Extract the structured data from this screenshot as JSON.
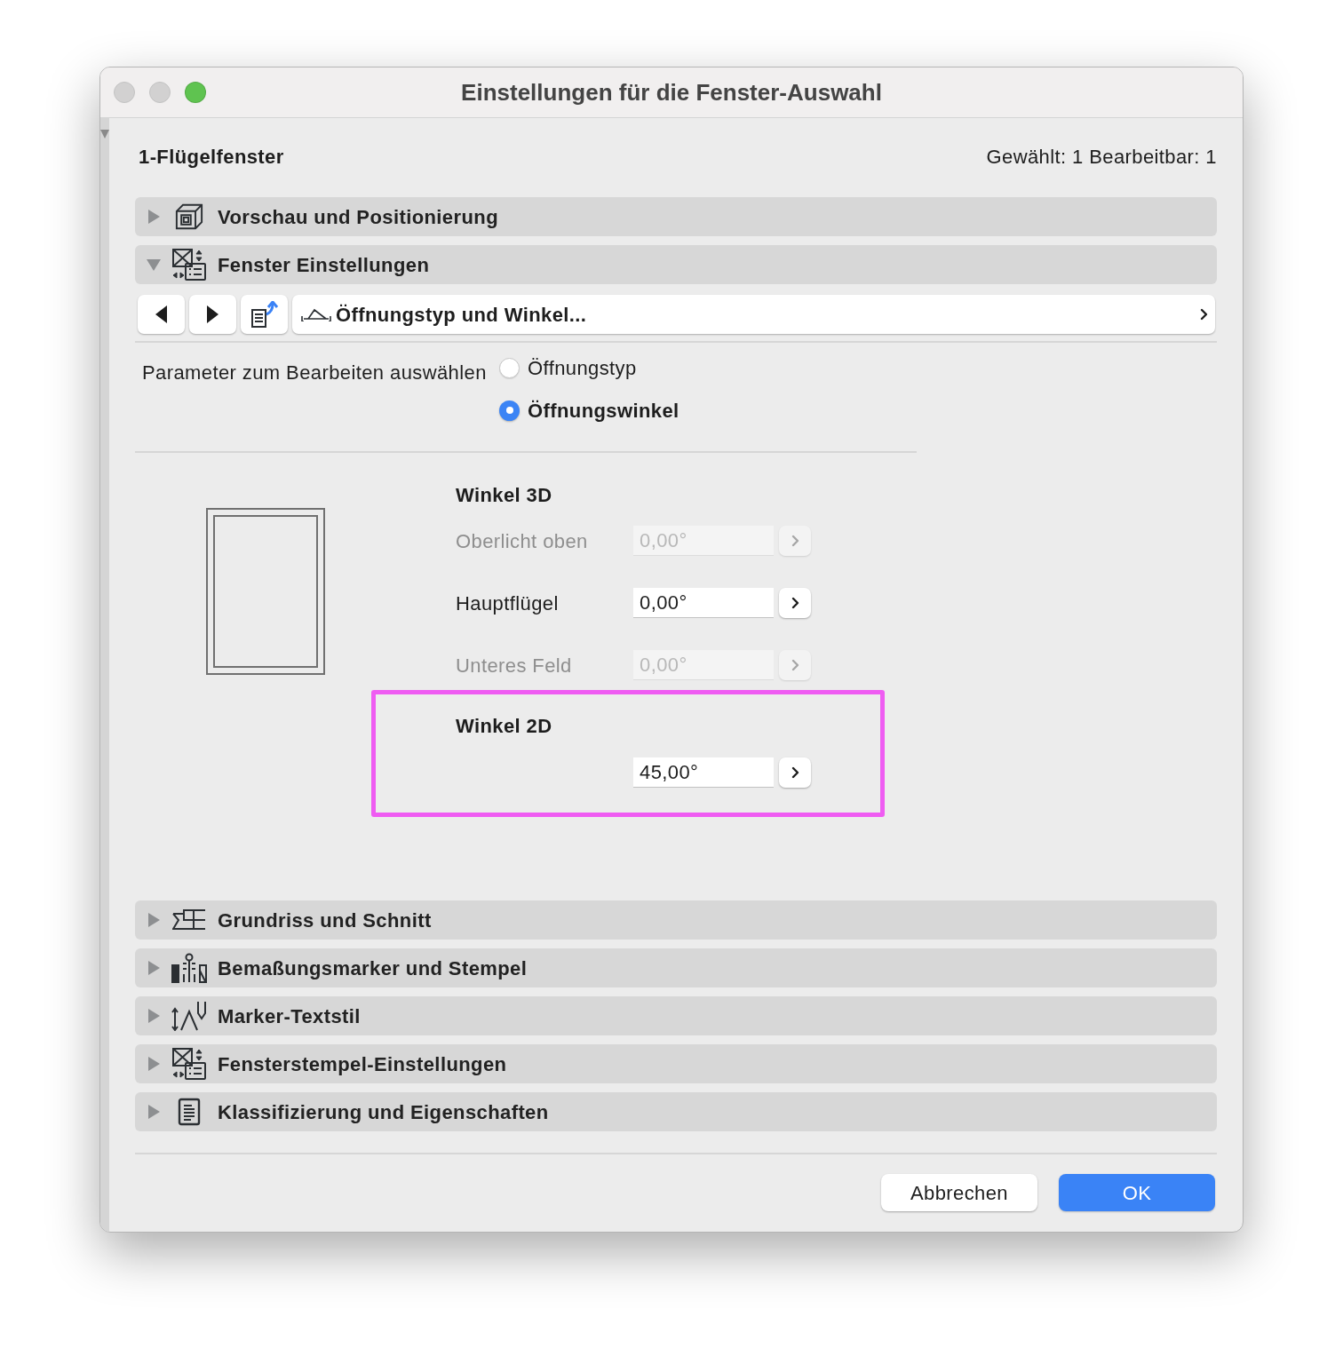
{
  "window": {
    "title": "Einstellungen für die Fenster-Auswahl",
    "traffic_lights": [
      {
        "kind": "close",
        "enabled": false
      },
      {
        "kind": "minimize",
        "enabled": false
      },
      {
        "kind": "zoom",
        "enabled": true
      }
    ]
  },
  "header": {
    "element_type": "1-Flügelfenster",
    "selection_info": "Gewählt: 1 Bearbeitbar: 1"
  },
  "sections": [
    {
      "kind": "preview",
      "title": "Vorschau und Positionierung",
      "expanded": false
    },
    {
      "kind": "window",
      "title": "Fenster Einstellungen",
      "expanded": true,
      "panel": {
        "page_selector": {
          "label": "Öffnungstyp und Winkel..."
        },
        "parameter_choice": {
          "label": "Parameter zum Bearbeiten auswählen",
          "options": [
            {
              "label": "Öffnungstyp",
              "selected": false
            },
            {
              "label": "Öffnungswinkel",
              "selected": true
            }
          ]
        },
        "angles_3d": {
          "heading": "Winkel 3D",
          "rows": [
            {
              "label": "Oberlicht oben",
              "value": "0,00°",
              "disabled": true
            },
            {
              "label": "Hauptflügel",
              "value": "0,00°",
              "disabled": false
            },
            {
              "label": "Unteres Feld",
              "value": "0,00°",
              "disabled": true
            }
          ]
        },
        "angles_2d": {
          "heading": "Winkel 2D",
          "highlighted": true,
          "value": "45,00°",
          "disabled": false
        }
      }
    },
    {
      "kind": "floor-plan",
      "title": "Grundriss und Schnitt",
      "expanded": false
    },
    {
      "kind": "dimension",
      "title": "Bemaßungsmarker und Stempel",
      "expanded": false
    },
    {
      "kind": "text-style",
      "title": "Marker-Textstil",
      "expanded": false
    },
    {
      "kind": "stamp",
      "title": "Fensterstempel-Einstellungen",
      "expanded": false
    },
    {
      "kind": "classification",
      "title": "Klassifizierung und Eigenschaften",
      "expanded": false
    }
  ],
  "buttons": [
    {
      "kind": "cancel",
      "label": "Abbrechen"
    },
    {
      "kind": "default",
      "label": "OK"
    }
  ]
}
